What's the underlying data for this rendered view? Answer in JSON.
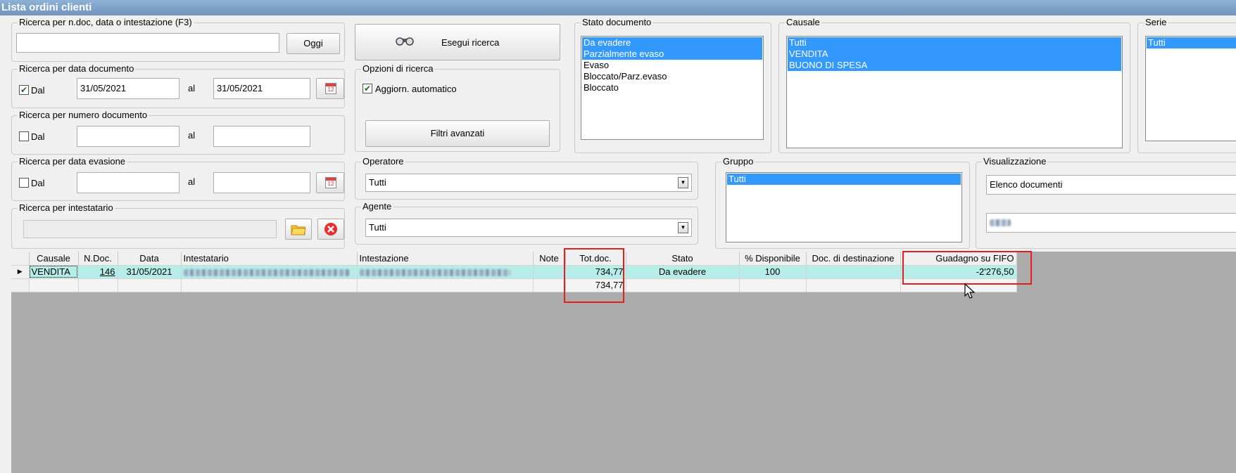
{
  "window": {
    "title": "Lista ordini clienti"
  },
  "search_quick": {
    "label": "Ricerca per n.doc, data o intestazione (F3)",
    "value": "",
    "today_button": "Oggi"
  },
  "search_date": {
    "label": "Ricerca per data documento",
    "from_checked": true,
    "from_label": "Dal",
    "from_value": "31/05/2021",
    "to_label": "al",
    "to_value": "31/05/2021"
  },
  "search_number": {
    "label": "Ricerca per numero documento",
    "from_checked": false,
    "from_label": "Dal",
    "from_value": "",
    "to_label": "al",
    "to_value": ""
  },
  "search_evasion": {
    "label": "Ricerca per data evasione",
    "from_checked": false,
    "from_label": "Dal",
    "from_value": "",
    "to_label": "al",
    "to_value": ""
  },
  "search_holder": {
    "label": "Ricerca per intestatario",
    "value": ""
  },
  "actions": {
    "search_button": "Esegui ricerca",
    "advanced_filters": "Filtri avanzati"
  },
  "search_options": {
    "label": "Opzioni di ricerca",
    "auto_update_checked": true,
    "auto_update_label": "Aggiorn. automatico"
  },
  "operator": {
    "label": "Operatore",
    "value": "Tutti"
  },
  "agent": {
    "label": "Agente",
    "value": "Tutti"
  },
  "doc_status": {
    "label": "Stato documento",
    "items": [
      {
        "text": "Da evadere",
        "selected": true
      },
      {
        "text": "Parzialmente evaso",
        "selected": true
      },
      {
        "text": "Evaso",
        "selected": false
      },
      {
        "text": "Bloccato/Parz.evaso",
        "selected": false
      },
      {
        "text": "Bloccato",
        "selected": false
      }
    ]
  },
  "causale": {
    "label": "Causale",
    "items": [
      {
        "text": "Tutti",
        "selected": true
      },
      {
        "text": "VENDITA",
        "selected": true
      },
      {
        "text": "BUONO DI SPESA",
        "selected": true
      }
    ]
  },
  "serie": {
    "label": "Serie",
    "items": [
      {
        "text": "Tutti",
        "selected": true
      }
    ]
  },
  "gruppo": {
    "label": "Gruppo",
    "items": [
      {
        "text": "Tutti",
        "selected": true
      }
    ]
  },
  "visualizzazione": {
    "label": "Visualizzazione",
    "value": "Elenco documenti",
    "second_value": ""
  },
  "grid": {
    "columns": [
      "Causale",
      "N.Doc.",
      "Data",
      "Intestatario",
      "Intestazione",
      "Note",
      "Tot.doc.",
      "Stato",
      "% Disponibile",
      "Doc. di destinazione",
      "Guadagno su FIFO"
    ],
    "rows": [
      {
        "causale": "VENDITA",
        "ndoc": "146",
        "data": "31/05/2021",
        "intestatario": "",
        "intestazione": "",
        "note": "",
        "totdoc": "734,77",
        "stato": "Da evadere",
        "disponibile": "100",
        "destinazione": "",
        "guadagno": "-2'276,50"
      }
    ],
    "totals": {
      "totdoc": "734,77"
    }
  },
  "colors": {
    "selection": "#3399ff",
    "row_highlight": "#b7ede8",
    "grid_background": "#ababab",
    "annotation": "#e02020"
  }
}
